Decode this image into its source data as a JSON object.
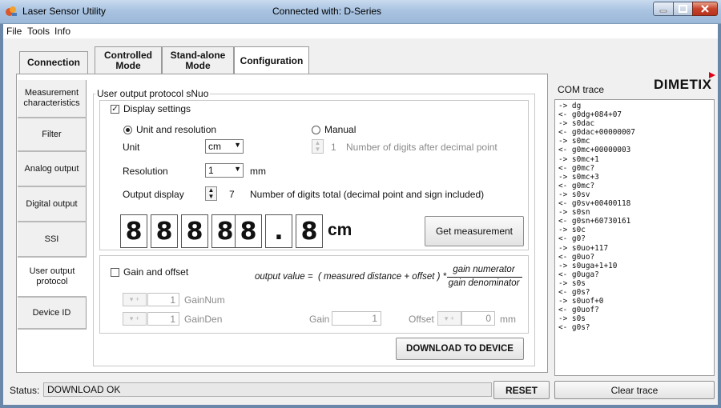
{
  "window": {
    "app_title": "Laser Sensor Utility",
    "connection_title": "Connected with: D-Series"
  },
  "menu": [
    "File",
    "Tools",
    "Info"
  ],
  "top_tabs": [
    {
      "label": "Connection",
      "active": false
    },
    {
      "label": "Controlled\nMode",
      "active": false
    },
    {
      "label": "Stand-alone\nMode",
      "active": false
    },
    {
      "label": "Configuration",
      "active": true
    }
  ],
  "side_tabs": [
    {
      "label": "Measurement characteristics",
      "active": false
    },
    {
      "label": "Filter",
      "active": false
    },
    {
      "label": "Analog output",
      "active": false
    },
    {
      "label": "Digital output",
      "active": false
    },
    {
      "label": "SSI",
      "active": false
    },
    {
      "label": "User output protocol",
      "active": true
    },
    {
      "label": "Device ID",
      "active": false
    }
  ],
  "protocol": {
    "group_title": "User output protocol sNuo",
    "display_settings": {
      "label": "Display settings",
      "checked": true,
      "unit_resolution_label": "Unit and resolution",
      "manual_label": "Manual",
      "selected_mode": "unit_and_resolution",
      "unit_label": "Unit",
      "unit_value": "cm",
      "resolution_label": "Resolution",
      "resolution_value": "1",
      "resolution_unit": "mm",
      "manual_digits_value": "1",
      "manual_digits_label": "Number of digits after decimal point",
      "output_display_label": "Output display",
      "output_digits_value": "7",
      "output_digits_label": "Number of digits total (decimal point and sign included)",
      "digits": [
        "8",
        "8",
        "8",
        "8",
        "8",
        ".",
        "8"
      ],
      "display_unit": "cm",
      "get_measurement_label": "Get measurement"
    },
    "gain_offset": {
      "label": "Gain and offset",
      "checked": false,
      "formula_left": "output value =",
      "formula_expr": "( measured distance + offset ) *",
      "formula_numerator": "gain numerator",
      "formula_denominator": "gain denominator",
      "gain_num_value": "1",
      "gain_num_label": "GainNum",
      "gain_den_value": "1",
      "gain_den_label": "GainDen",
      "gain_label": "Gain",
      "gain_value": "1",
      "offset_label": "Offset",
      "offset_value": "0",
      "offset_unit": "mm"
    },
    "download_label": "DOWNLOAD TO DEVICE"
  },
  "com_trace": {
    "label": "COM trace",
    "logo": "DIMETIX",
    "lines": [
      "-> dg",
      "<- g0dg+084+07",
      "-> s0dac",
      "<- g0dac+00000007",
      "-> s0mc",
      "<- g0mc+00000003",
      "-> s0mc+1",
      "<- g0mc?",
      "-> s0mc+3",
      "<- g0mc?",
      "-> s0sv",
      "<- g0sv+00400118",
      "-> s0sn",
      "<- g0sn+60730161",
      "-> s0c",
      "<- g0?",
      "-> s0uo+117",
      "<- g0uo?",
      "-> s0uga+1+10",
      "<- g0uga?",
      "-> s0s",
      "<- g0s?",
      "-> s0uof+0",
      "<- g0uof?",
      "-> s0s",
      "<- g0s?"
    ],
    "clear_label": "Clear trace"
  },
  "status": {
    "label": "Status:",
    "value": "DOWNLOAD OK",
    "reset_label": "RESET"
  },
  "colors": {
    "titlebar": "#a9c3e1",
    "logo_accent": "#e0001a",
    "panel": "#ffffff",
    "chrome": "#f0f0f0"
  }
}
